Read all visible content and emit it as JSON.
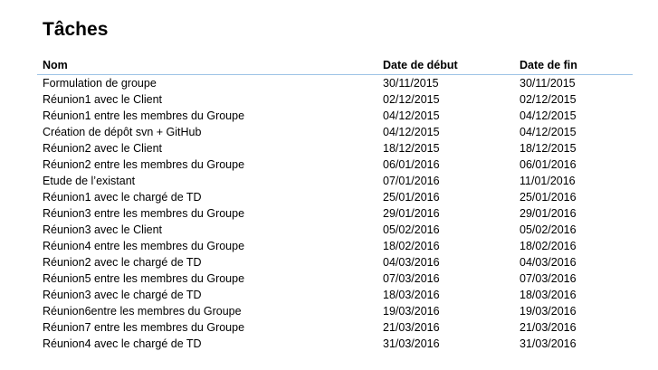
{
  "title": "Tâches",
  "headers": {
    "nom": "Nom",
    "debut": "Date de début",
    "fin": "Date de fin"
  },
  "tasks": [
    {
      "nom": "Formulation de groupe",
      "debut": "30/11/2015",
      "fin": "30/11/2015"
    },
    {
      "nom": "Réunion1 avec le Client",
      "debut": "02/12/2015",
      "fin": "02/12/2015"
    },
    {
      "nom": "Réunion1 entre les membres du Groupe",
      "debut": "04/12/2015",
      "fin": "04/12/2015"
    },
    {
      "nom": "Création de dépôt svn + GitHub",
      "debut": "04/12/2015",
      "fin": "04/12/2015"
    },
    {
      "nom": "Réunion2 avec le Client",
      "debut": "18/12/2015",
      "fin": "18/12/2015"
    },
    {
      "nom": "Réunion2 entre les membres du Groupe",
      "debut": "06/01/2016",
      "fin": "06/01/2016"
    },
    {
      "nom": "Etude de l’existant",
      "debut": "07/01/2016",
      "fin": "11/01/2016"
    },
    {
      "nom": "Réunion1 avec le chargé de TD",
      "debut": "25/01/2016",
      "fin": "25/01/2016"
    },
    {
      "nom": "Réunion3 entre les membres du Groupe",
      "debut": "29/01/2016",
      "fin": "29/01/2016"
    },
    {
      "nom": "Réunion3 avec le Client",
      "debut": "05/02/2016",
      "fin": "05/02/2016"
    },
    {
      "nom": "Réunion4 entre les membres du Groupe",
      "debut": "18/02/2016",
      "fin": "18/02/2016"
    },
    {
      "nom": "Réunion2 avec le chargé de TD",
      "debut": "04/03/2016",
      "fin": "04/03/2016"
    },
    {
      "nom": "Réunion5 entre les membres du Groupe",
      "debut": "07/03/2016",
      "fin": "07/03/2016"
    },
    {
      "nom": "Réunion3 avec le chargé de TD",
      "debut": "18/03/2016",
      "fin": "18/03/2016"
    },
    {
      "nom": "Réunion6entre les membres du Groupe",
      "debut": "19/03/2016",
      "fin": "19/03/2016"
    },
    {
      "nom": "Réunion7 entre les membres du Groupe",
      "debut": "21/03/2016",
      "fin": "21/03/2016"
    },
    {
      "nom": "Réunion4 avec le chargé de TD",
      "debut": "31/03/2016",
      "fin": "31/03/2016"
    }
  ]
}
